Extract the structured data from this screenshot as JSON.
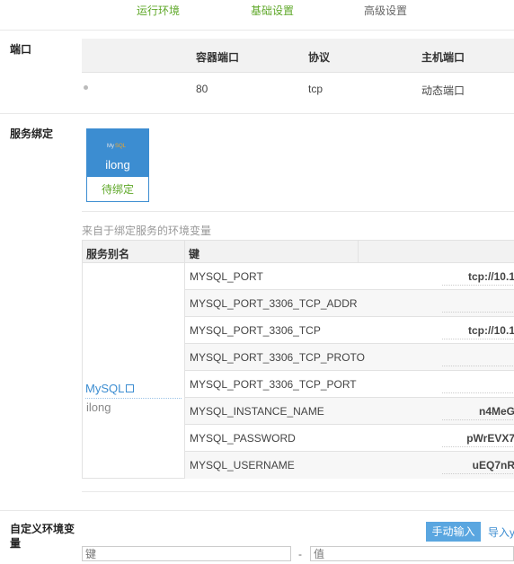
{
  "steps": [
    "运行环境",
    "基础设置",
    "高级设置"
  ],
  "ports": {
    "label": "端口",
    "headers": [
      "容器端口",
      "协议",
      "主机端口"
    ],
    "rows": [
      {
        "container_port": "80",
        "protocol": "tcp",
        "host_port": "动态端口"
      }
    ]
  },
  "binding": {
    "label": "服务绑定",
    "service": {
      "name": "ilong",
      "status": "待绑定"
    }
  },
  "env": {
    "title": "来自于绑定服务的环境变量",
    "headers": [
      "服务别名",
      "键"
    ],
    "alias": "MySQL",
    "alias_sub": "ilong",
    "rows": [
      {
        "key": "MYSQL_PORT",
        "value": "tcp://10.1"
      },
      {
        "key": "MYSQL_PORT_3306_TCP_ADDR",
        "value": ""
      },
      {
        "key": "MYSQL_PORT_3306_TCP",
        "value": "tcp://10.1"
      },
      {
        "key": "MYSQL_PORT_3306_TCP_PROTO",
        "value": ""
      },
      {
        "key": "MYSQL_PORT_3306_TCP_PORT",
        "value": ""
      },
      {
        "key": "MYSQL_INSTANCE_NAME",
        "value": "n4MeG"
      },
      {
        "key": "MYSQL_PASSWORD",
        "value": "pWrEVX7"
      },
      {
        "key": "MYSQL_USERNAME",
        "value": "uEQ7nR"
      }
    ]
  },
  "custom_env": {
    "label": "自定义环境变量",
    "manual_button": "手动输入",
    "import_link": "导入y",
    "key_placeholder": "键",
    "value_placeholder": "值",
    "separator": "-"
  },
  "colors": {
    "accent_green": "#5fa829",
    "accent_blue": "#3c8dd1"
  }
}
